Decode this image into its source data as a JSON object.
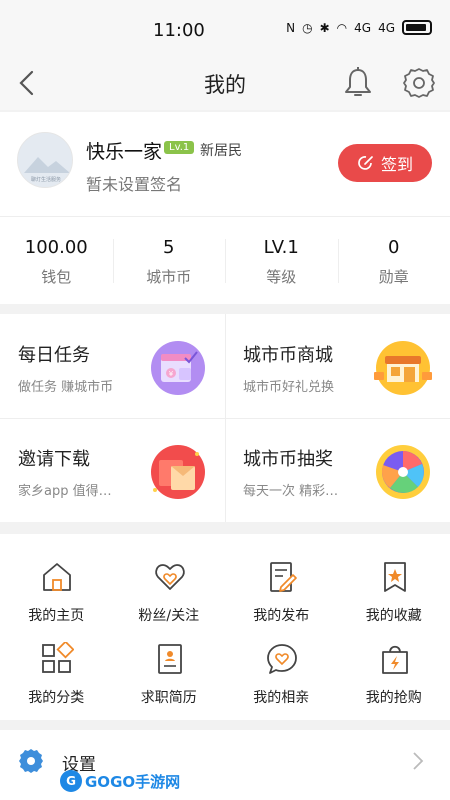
{
  "status_bar": {
    "time": "11:00",
    "signal_1": "4G",
    "signal_2": "4G"
  },
  "nav": {
    "title": "我的"
  },
  "profile": {
    "name": "快乐一家",
    "level_badge": "Lv.1",
    "title": "新居民",
    "signature": "暂未设置签名",
    "checkin_label": "签到",
    "avatar_caption": "聊灯生活服务"
  },
  "stats": [
    {
      "value": "100.00",
      "label": "钱包"
    },
    {
      "value": "5",
      "label": "城市币"
    },
    {
      "value": "LV.1",
      "label": "等级"
    },
    {
      "value": "0",
      "label": "勋章"
    }
  ],
  "cards": [
    {
      "title": "每日任务",
      "subtitle": "做任务 赚城市币",
      "icon": "task-icon"
    },
    {
      "title": "城市币商城",
      "subtitle": "城市币好礼兑换",
      "icon": "shop-icon"
    },
    {
      "title": "邀请下载",
      "subtitle": "家乡app 值得…",
      "icon": "invite-envelope-icon"
    },
    {
      "title": "城市币抽奖",
      "subtitle": "每天一次 精彩…",
      "icon": "lottery-wheel-icon"
    }
  ],
  "grid": [
    {
      "label": "我的主页",
      "icon": "home-icon"
    },
    {
      "label": "粉丝/关注",
      "icon": "heart-icon"
    },
    {
      "label": "我的发布",
      "icon": "publish-icon"
    },
    {
      "label": "我的收藏",
      "icon": "bookmark-icon"
    },
    {
      "label": "我的分类",
      "icon": "category-icon"
    },
    {
      "label": "求职简历",
      "icon": "resume-icon"
    },
    {
      "label": "我的相亲",
      "icon": "dating-icon"
    },
    {
      "label": "我的抢购",
      "icon": "flash-sale-icon"
    }
  ],
  "settings": {
    "label": "设置"
  },
  "watermark": {
    "text": "GOGO手游网",
    "mark": "G"
  },
  "colors": {
    "accent": "#e94a4a",
    "icon_orange": "#f08a2a",
    "badge_green": "#8bc34a",
    "settings_blue": "#3d8edb"
  }
}
